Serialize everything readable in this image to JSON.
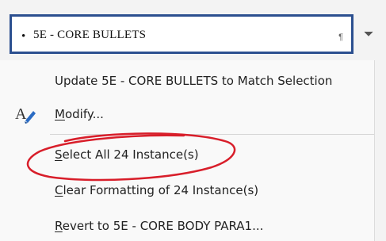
{
  "style_box": {
    "bullet": "•",
    "style_name": "5E - CORE BULLETS",
    "pilcrow": "¶"
  },
  "dropdown": {
    "icon": "chevron-down-icon"
  },
  "menu": {
    "update": {
      "label": "Update 5E - CORE BULLETS to Match Selection"
    },
    "modify": {
      "mnemonic": "M",
      "rest": "odify...",
      "icon": "modify-style-icon"
    },
    "select_all": {
      "mnemonic": "S",
      "rest": "elect All 24 Instance(s)"
    },
    "clear": {
      "mnemonic": "C",
      "rest": "lear Formatting of 24 Instance(s)"
    },
    "revert": {
      "mnemonic": "R",
      "rest": "evert to 5E - CORE BODY PARA1..."
    }
  },
  "annotation": {
    "color": "#d81e2a"
  },
  "colors": {
    "box_border": "#2b4f8f",
    "icon_blue": "#2b6cc4",
    "menu_bg": "#f9f9f9"
  }
}
